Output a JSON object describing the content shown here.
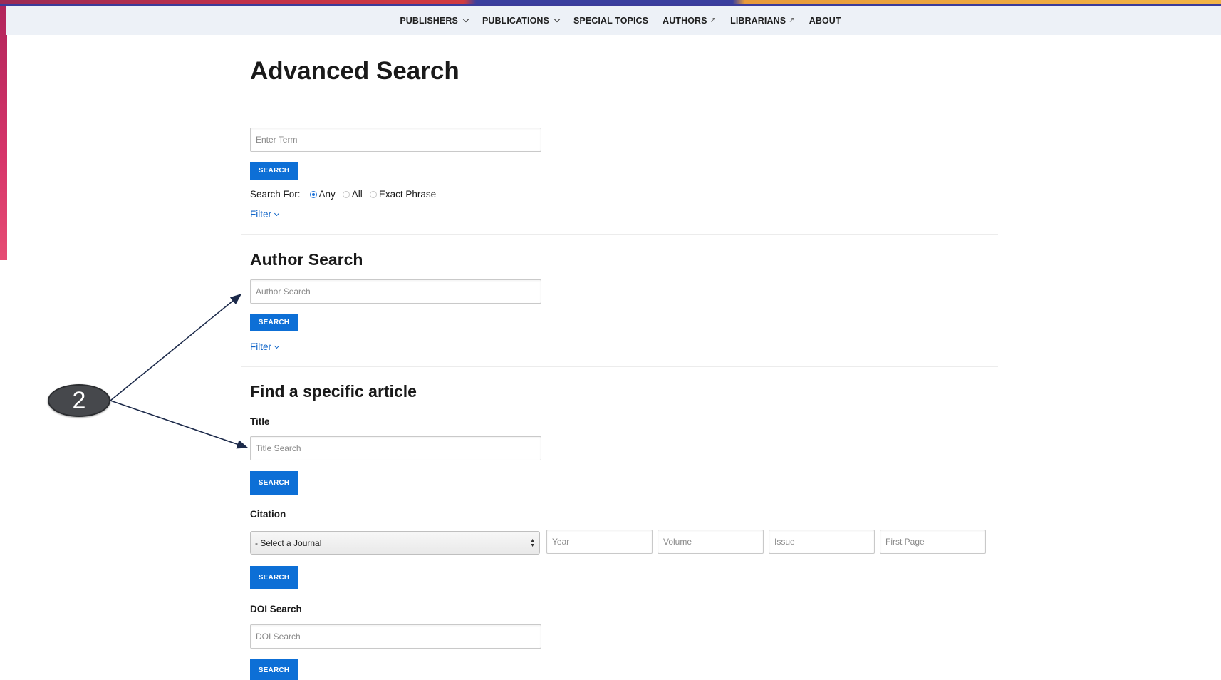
{
  "nav": {
    "items": [
      {
        "label": "PUBLISHERS",
        "dropdown": true,
        "external": false
      },
      {
        "label": "PUBLICATIONS",
        "dropdown": true,
        "external": false
      },
      {
        "label": "SPECIAL TOPICS",
        "dropdown": false,
        "external": false
      },
      {
        "label": "AUTHORS",
        "dropdown": false,
        "external": true
      },
      {
        "label": "LIBRARIANS",
        "dropdown": false,
        "external": true
      },
      {
        "label": "ABOUT",
        "dropdown": false,
        "external": false
      }
    ]
  },
  "page": {
    "title": "Advanced Search"
  },
  "general_search": {
    "placeholder": "Enter Term",
    "button": "SEARCH",
    "search_for_label": "Search For:",
    "options": [
      "Any",
      "All",
      "Exact Phrase"
    ],
    "selected": "Any",
    "filter": "Filter"
  },
  "author_search": {
    "title": "Author Search",
    "placeholder": "Author Search",
    "button": "SEARCH",
    "filter": "Filter"
  },
  "article": {
    "title": "Find a specific article",
    "title_label": "Title",
    "title_placeholder": "Title Search",
    "title_button": "SEARCH",
    "citation_label": "Citation",
    "journal_select": "- Select a Journal",
    "year_placeholder": "Year",
    "volume_placeholder": "Volume",
    "issue_placeholder": "Issue",
    "first_page_placeholder": "First Page",
    "citation_button": "SEARCH",
    "doi_label": "DOI Search",
    "doi_placeholder": "DOI Search",
    "doi_button": "SEARCH"
  },
  "annotation": {
    "callout_number": "2"
  },
  "colors": {
    "accent": "#0d6fd6",
    "link": "#1065c8",
    "nav_bg": "#edf1f7",
    "callout": "#46484c"
  }
}
